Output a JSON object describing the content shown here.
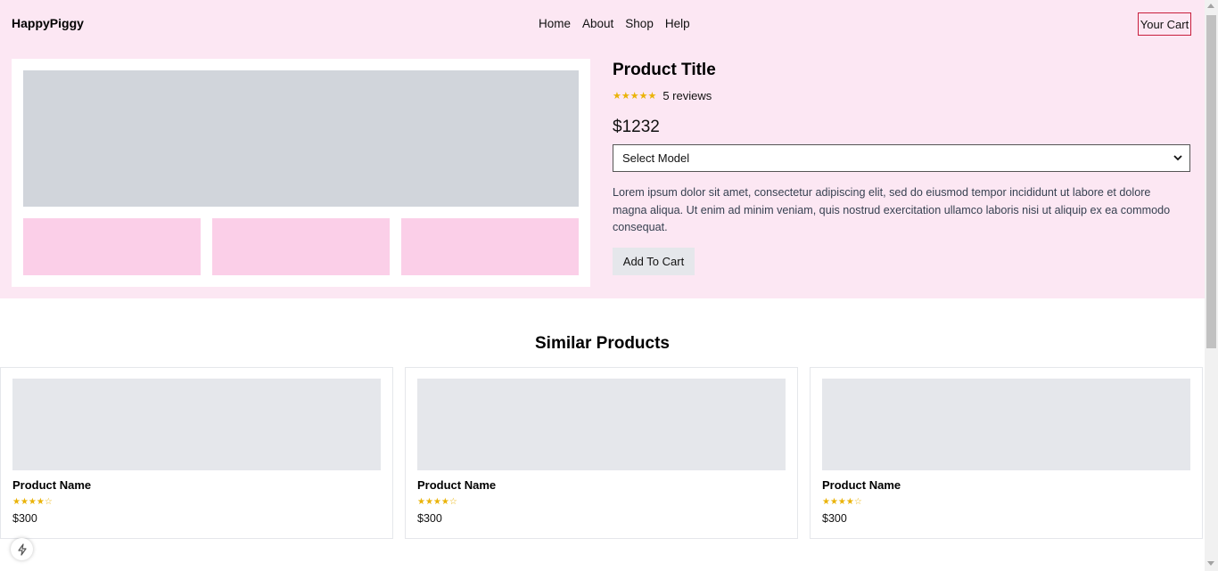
{
  "header": {
    "logo": "HappyPiggy",
    "nav": [
      "Home",
      "About",
      "Shop",
      "Help"
    ],
    "cart_label": "Your Cart"
  },
  "product": {
    "title": "Product Title",
    "stars": "★★★★★",
    "rating_value": 5,
    "reviews": "5 reviews",
    "price": "$1232",
    "select_value": "Select Model",
    "description": "Lorem ipsum dolor sit amet, consectetur adipiscing elit, sed do eiusmod tempor incididunt ut labore et dolore magna aliqua. Ut enim ad minim veniam, quis nostrud exercitation ullamco laboris nisi ut aliquip ex ea commodo consequat.",
    "add_to_cart": "Add To Cart"
  },
  "similar": {
    "title": "Similar Products",
    "products": [
      {
        "name": "Product Name",
        "stars": "★★★★☆",
        "rating_value": 4,
        "price": "$300"
      },
      {
        "name": "Product Name",
        "stars": "★★★★☆",
        "rating_value": 4,
        "price": "$300"
      },
      {
        "name": "Product Name",
        "stars": "★★★★☆",
        "rating_value": 4,
        "price": "$300"
      }
    ]
  },
  "icons": {
    "dropdown": "chevron-down-icon",
    "dev_badge": "lightning-icon"
  },
  "colors": {
    "hero_background": "#fce7f3",
    "main_image_placeholder": "#d1d5db",
    "thumbnail_placeholder": "#fbcfe8",
    "card_image_placeholder": "#e5e7eb",
    "star_color": "#eab308",
    "cart_border": "#c81e3c"
  }
}
